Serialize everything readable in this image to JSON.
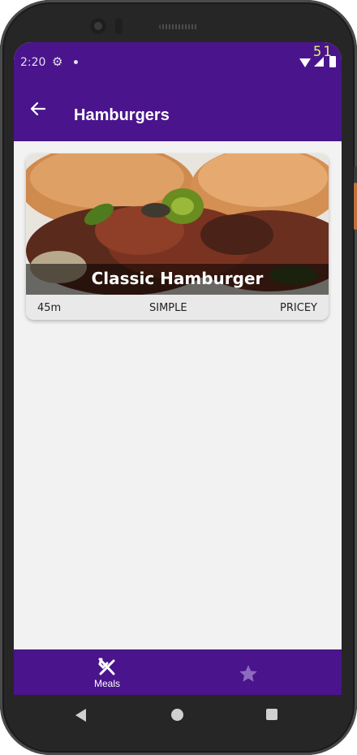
{
  "status": {
    "time": "2:20",
    "fps": "51",
    "settings_icon": "gear-icon",
    "notification_icon": "dot-icon",
    "wifi_icon": "wifi-icon",
    "signal_icon": "signal-icon",
    "battery_icon": "battery-icon"
  },
  "appbar": {
    "title": "Hamburgers",
    "back_icon": "arrow-left-icon"
  },
  "meal": {
    "title": "Classic Hamburger",
    "duration": "45m",
    "complexity": "SIMPLE",
    "affordability": "PRICEY"
  },
  "bottom_nav": {
    "tabs": [
      {
        "label": "Meals",
        "icon": "fork-knife-icon",
        "selected": true
      },
      {
        "label": "",
        "icon": "star-icon",
        "selected": false
      }
    ]
  },
  "colors": {
    "primary": "#4a148c",
    "background": "#f2f2f2",
    "unselected_icon": "#8d6bbf"
  }
}
